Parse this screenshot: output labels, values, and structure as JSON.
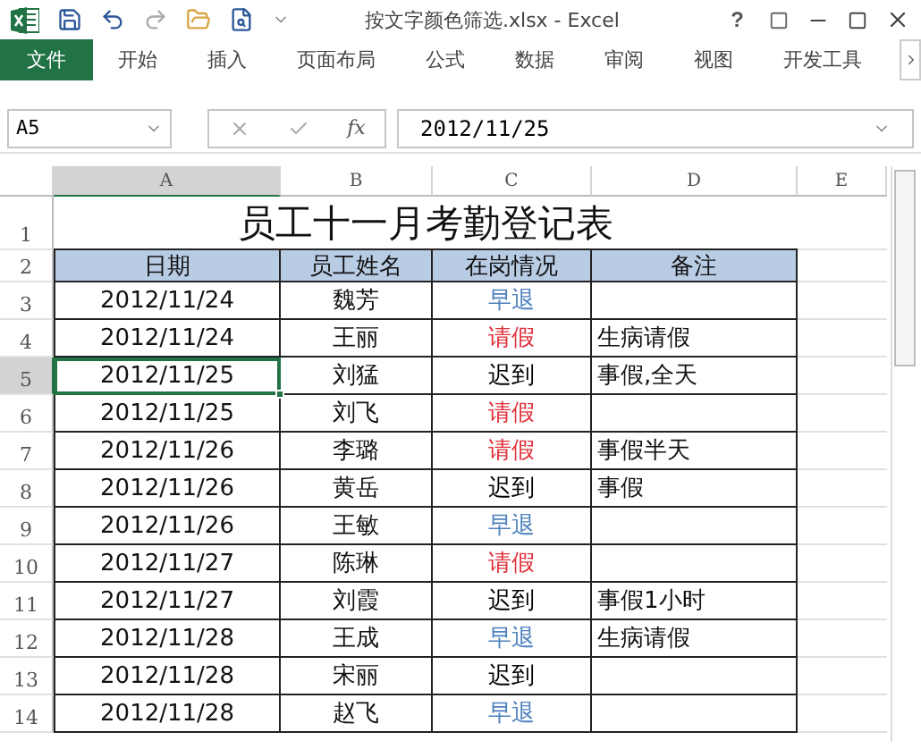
{
  "window": {
    "title": "按文字颜色筛选.xlsx - Excel",
    "help": "?"
  },
  "ribbon_tabs": [
    {
      "label": "文件",
      "kind": "file"
    },
    {
      "label": "开始",
      "kind": "tab"
    },
    {
      "label": "插入",
      "kind": "tab"
    },
    {
      "label": "页面布局",
      "kind": "tab"
    },
    {
      "label": "公式",
      "kind": "tab"
    },
    {
      "label": "数据",
      "kind": "tab"
    },
    {
      "label": "审阅",
      "kind": "tab"
    },
    {
      "label": "视图",
      "kind": "tab"
    },
    {
      "label": "开发工具",
      "kind": "tab"
    }
  ],
  "formula_bar": {
    "name_box": "A5",
    "fx_label": "fx",
    "value": "2012/11/25"
  },
  "columns": [
    "A",
    "B",
    "C",
    "D",
    "E"
  ],
  "sheet": {
    "title_row": "1",
    "title": "员工十一月考勤登记表",
    "header_row": "2",
    "headers": [
      "日期",
      "员工姓名",
      "在岗情况",
      "备注"
    ],
    "rows": [
      {
        "row": "3",
        "date": "2012/11/24",
        "name": "魏芳",
        "status": "早退",
        "color": "#4f81bd",
        "note": "",
        "selected": false
      },
      {
        "row": "4",
        "date": "2012/11/24",
        "name": "王丽",
        "status": "请假",
        "color": "#e0303a",
        "note": "生病请假",
        "selected": false
      },
      {
        "row": "5",
        "date": "2012/11/25",
        "name": "刘猛",
        "status": "迟到",
        "color": "#000000",
        "note": "事假,全天",
        "selected": true
      },
      {
        "row": "6",
        "date": "2012/11/25",
        "name": "刘飞",
        "status": "请假",
        "color": "#e0303a",
        "note": "",
        "selected": false
      },
      {
        "row": "7",
        "date": "2012/11/26",
        "name": "李璐",
        "status": "请假",
        "color": "#e0303a",
        "note": "事假半天",
        "selected": false
      },
      {
        "row": "8",
        "date": "2012/11/26",
        "name": "黄岳",
        "status": "迟到",
        "color": "#000000",
        "note": "事假",
        "selected": false
      },
      {
        "row": "9",
        "date": "2012/11/26",
        "name": "王敏",
        "status": "早退",
        "color": "#4f81bd",
        "note": "",
        "selected": false
      },
      {
        "row": "10",
        "date": "2012/11/27",
        "name": "陈琳",
        "status": "请假",
        "color": "#e0303a",
        "note": "",
        "selected": false
      },
      {
        "row": "11",
        "date": "2012/11/27",
        "name": "刘霞",
        "status": "迟到",
        "color": "#000000",
        "note": "事假1小时",
        "selected": false
      },
      {
        "row": "12",
        "date": "2012/11/28",
        "name": "王成",
        "status": "早退",
        "color": "#4f81bd",
        "note": "生病请假",
        "selected": false
      },
      {
        "row": "13",
        "date": "2012/11/28",
        "name": "宋丽",
        "status": "迟到",
        "color": "#000000",
        "note": "",
        "selected": false
      },
      {
        "row": "14",
        "date": "2012/11/28",
        "name": "赵飞",
        "status": "早退",
        "color": "#4f81bd",
        "note": "",
        "selected": false
      }
    ]
  }
}
